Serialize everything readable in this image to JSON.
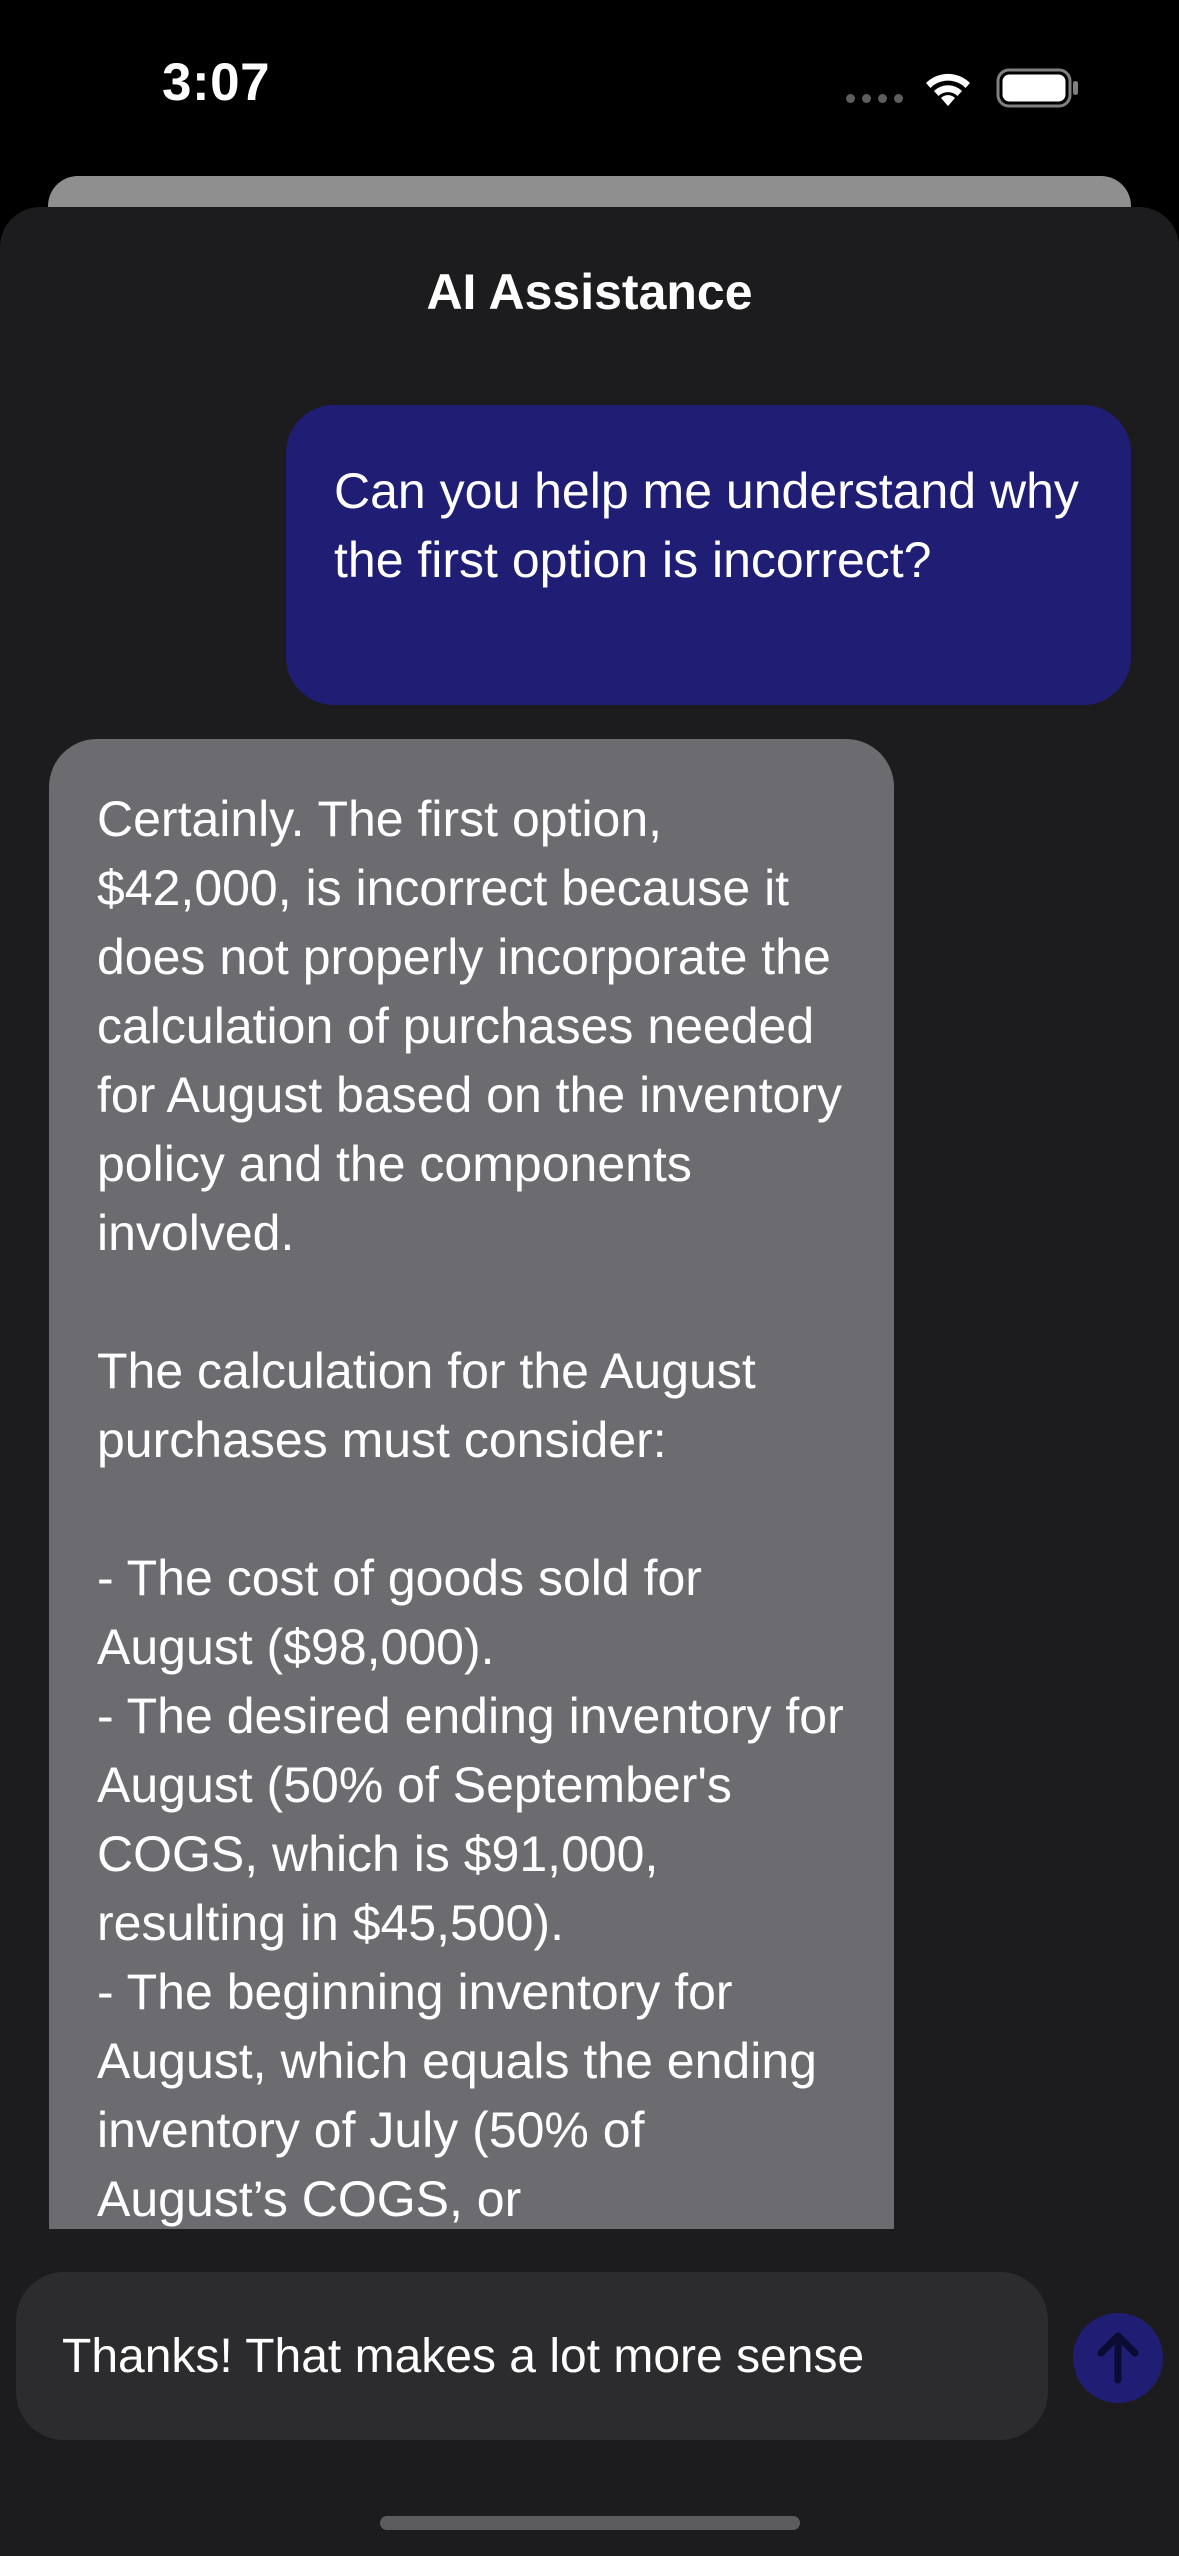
{
  "status_bar": {
    "time": "3:07",
    "wifi_icon": "wifi-icon",
    "battery_icon": "battery-icon"
  },
  "sheet": {
    "title": "AI Assistance"
  },
  "messages": [
    {
      "role": "user",
      "text": "Can you help me understand why the first option is incorrect?"
    },
    {
      "role": "assistant",
      "text": "Certainly. The first option, $42,000, is incorrect because it does not properly incorporate the calculation of purchases needed for August based on the inventory policy and the components involved.\n\nThe calculation for the August purchases must consider:\n\n- The cost of goods sold for August ($98,000).\n- The desired ending inventory for August (50% of September's COGS, which is $91,000, resulting in $45,500).\n- The beginning inventory for August, which equals the ending inventory of July (50% of August’s COGS, or"
    }
  ],
  "composer": {
    "value": "Thanks! That makes a lot more sense",
    "send_icon": "arrow-up-icon"
  },
  "colors": {
    "background": "#000000",
    "sheet": "#1c1c1e",
    "user_bubble": "#201e74",
    "assistant_bubble": "#6c6c70",
    "input": "#2c2c2e"
  }
}
